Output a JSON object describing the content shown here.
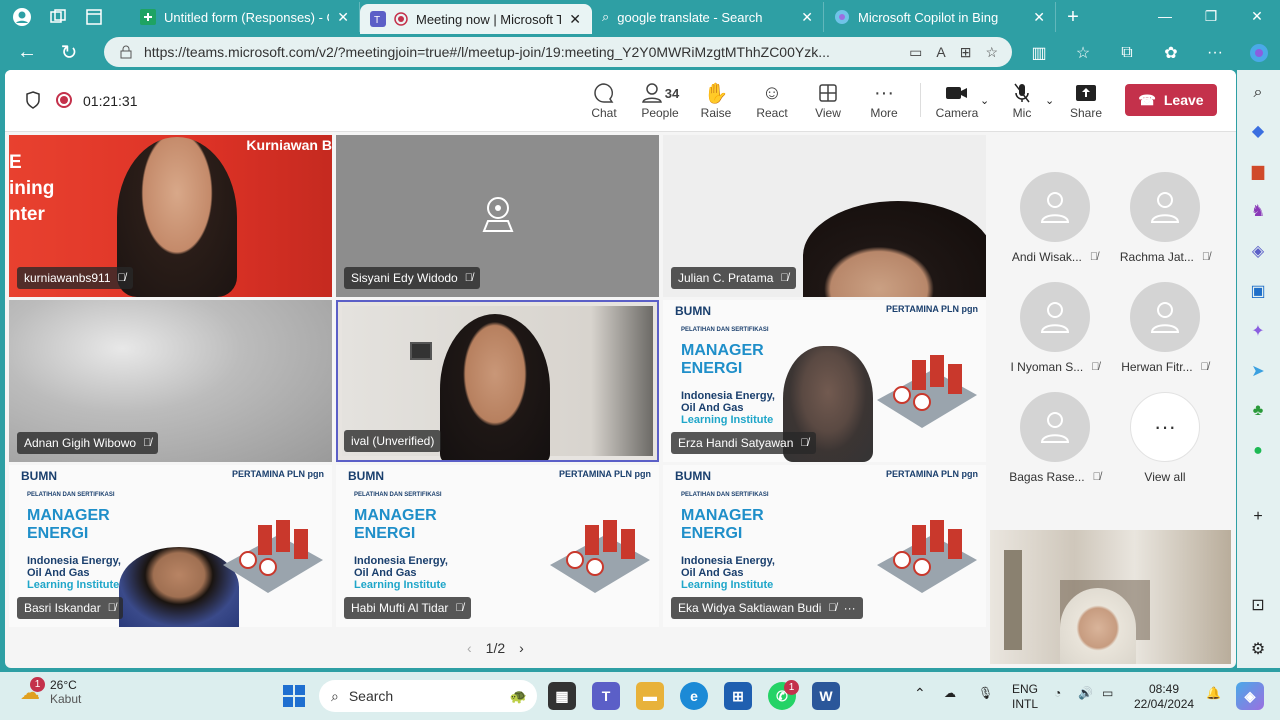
{
  "browser": {
    "tabs": [
      {
        "title": "Untitled form (Responses) - Goo",
        "icon": "google-sheets-icon"
      },
      {
        "title": "Meeting now | Microsoft Te",
        "icon": "teams-icon",
        "active": true
      },
      {
        "title": "google translate - Search",
        "icon": "search-icon"
      },
      {
        "title": "Microsoft Copilot in Bing",
        "icon": "copilot-icon"
      }
    ],
    "url": "https://teams.microsoft.com/v2/?meetingjoin=true#/l/meetup-join/19:meeting_Y2Y0MWRiMzgtMThhZC00Yzk..."
  },
  "meeting": {
    "timer": "01:21:31",
    "controls": {
      "chat": "Chat",
      "people": "People",
      "people_count": "34",
      "raise": "Raise",
      "react": "React",
      "view": "View",
      "more": "More",
      "camera": "Camera",
      "mic": "Mic",
      "share": "Share",
      "leave": "Leave"
    },
    "tiles": [
      {
        "name": "kurniawanbs911",
        "banner": "Kurniawan B",
        "bg_text": "E\nining\nnter"
      },
      {
        "name": "Sisyani Edy Widodo"
      },
      {
        "name": "Julian C. Pratama"
      },
      {
        "name": "Adnan Gigih Wibowo"
      },
      {
        "name": "ival (Unverified)"
      },
      {
        "name": "Erza Handi Satyawan"
      },
      {
        "name": "Basri Iskandar"
      },
      {
        "name": "Habi Mufti Al Tidar"
      },
      {
        "name": "Eka Widya Saktiawan Budi"
      }
    ],
    "slide": {
      "logo": "BUMN",
      "logo_sub": "UNTUK INDONESIA",
      "brands": "PERTAMINA  PLN  pgn",
      "small": "PELATIHAN DAN SERTIFIKASI",
      "title_1": "MANAGER",
      "title_2": "ENERGI",
      "sub_1": "Indonesia Energy,",
      "sub_2": "Oil And Gas",
      "sub_3": "Learning Institute"
    },
    "roster": [
      {
        "name": "Andi Wisak..."
      },
      {
        "name": "Rachma Jat..."
      },
      {
        "name": "I Nyoman S..."
      },
      {
        "name": "Herwan Fitr..."
      },
      {
        "name": "Bagas Rase..."
      }
    ],
    "view_all": "View all",
    "pager": "1/2"
  },
  "taskbar": {
    "weather_temp": "26°C",
    "weather_desc": "Kabut",
    "weather_badge": "1",
    "search": "Search",
    "whatsapp_badge": "1",
    "lang_1": "ENG",
    "lang_2": "INTL",
    "time": "08:49",
    "date": "22/04/2024"
  },
  "colors": {
    "browser_chrome": "#2e9fa4",
    "leave_red": "#c4314b",
    "slide_blue": "#1f8fc9",
    "teams_purple": "#5b5fc7"
  }
}
